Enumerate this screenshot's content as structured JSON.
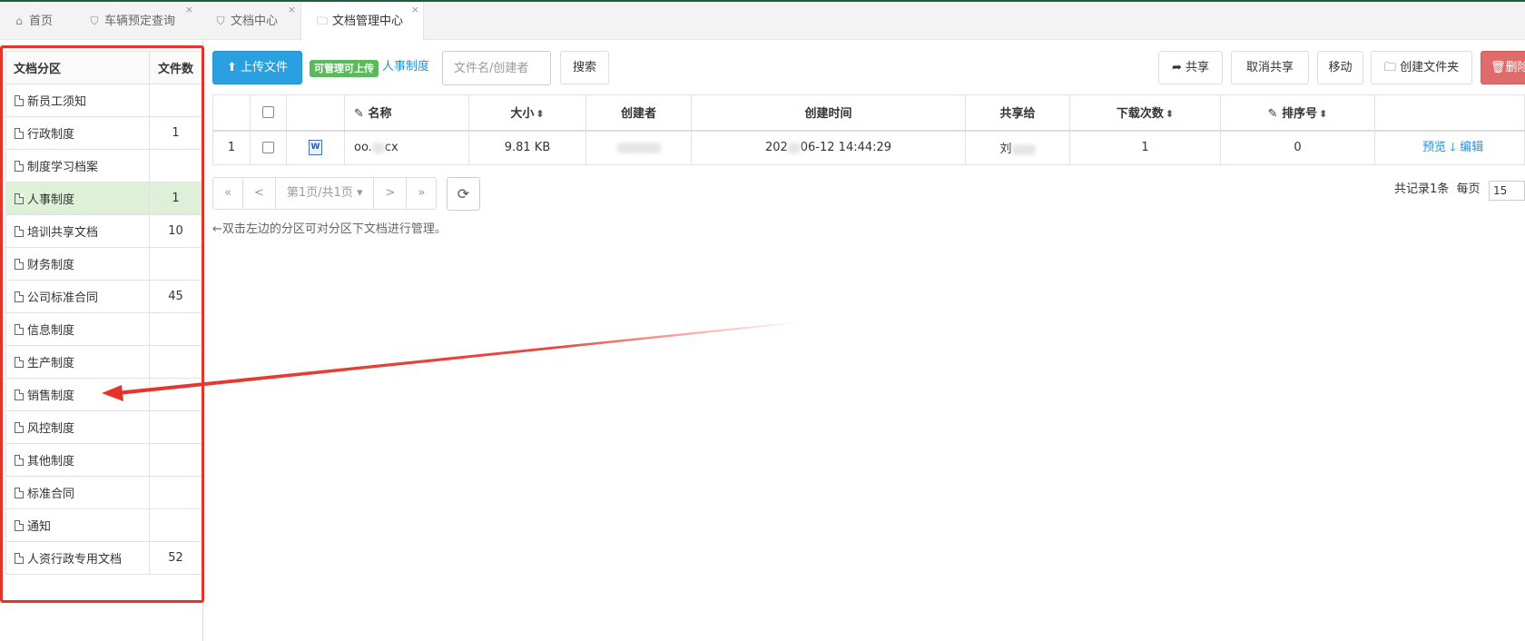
{
  "tabs": [
    {
      "icon": "home-icon",
      "label": "首页",
      "closable": false
    },
    {
      "icon": "bookmark-icon",
      "label": "车辆预定查询",
      "closable": true
    },
    {
      "icon": "bookmark-icon",
      "label": "文档中心",
      "closable": true
    },
    {
      "icon": "folder-icon",
      "label": "文档管理中心",
      "closable": true,
      "active": true
    }
  ],
  "close_glyph": "×",
  "sidebar": {
    "header_name": "文档分区",
    "header_count": "文件数",
    "selected": "人事制度",
    "items": [
      {
        "label": "新员工须知",
        "count": ""
      },
      {
        "label": "行政制度",
        "count": "1"
      },
      {
        "label": "制度学习档案",
        "count": ""
      },
      {
        "label": "人事制度",
        "count": "1"
      },
      {
        "label": "培训共享文档",
        "count": "10"
      },
      {
        "label": "财务制度",
        "count": ""
      },
      {
        "label": "公司标准合同",
        "count": "45"
      },
      {
        "label": "信息制度",
        "count": ""
      },
      {
        "label": "生产制度",
        "count": ""
      },
      {
        "label": "销售制度",
        "count": ""
      },
      {
        "label": "风控制度",
        "count": ""
      },
      {
        "label": "其他制度",
        "count": ""
      },
      {
        "label": "标准合同",
        "count": ""
      },
      {
        "label": "通知",
        "count": ""
      },
      {
        "label": "人资行政专用文档",
        "count": "52"
      }
    ]
  },
  "toolbar": {
    "upload_label": "上传文件",
    "badge": "可管理可上传",
    "current_category": "人事制度",
    "search_placeholder": "文件名/创建者",
    "search_label": "搜索",
    "share_label": "共享",
    "unshare_label": "取消共享",
    "move_label": "移动",
    "create_folder_label": "创建文件夹",
    "delete_label": "删除"
  },
  "table": {
    "columns": {
      "name": "名称",
      "size": "大小",
      "creator": "创建者",
      "created": "创建时间",
      "shared_to": "共享给",
      "downloads": "下载次数",
      "order": "排序号"
    },
    "rows": [
      {
        "index": "1",
        "name_start": "oo.",
        "name_end": "cx",
        "size": "9.81 KB",
        "creator": "",
        "created_start": "202",
        "created_end": "06-12 14:44:29",
        "shared_start": "刘",
        "downloads": "1",
        "order": "0",
        "preview": "预览",
        "edit": "编辑"
      }
    ]
  },
  "pagination": {
    "first": "«",
    "prev": "<",
    "current": "第1页/共1页",
    "next": ">",
    "last": "»",
    "total_text": "共记录1条",
    "per_page_label": "每页",
    "per_page": "15"
  },
  "hint": "←双击左边的分区可对分区下文档进行管理。",
  "colors": {
    "primary": "#2aa0e0",
    "success": "#5cb85c",
    "danger": "#e06b6b",
    "selected_row": "#dff0d8",
    "annotation": "#e5332a"
  }
}
